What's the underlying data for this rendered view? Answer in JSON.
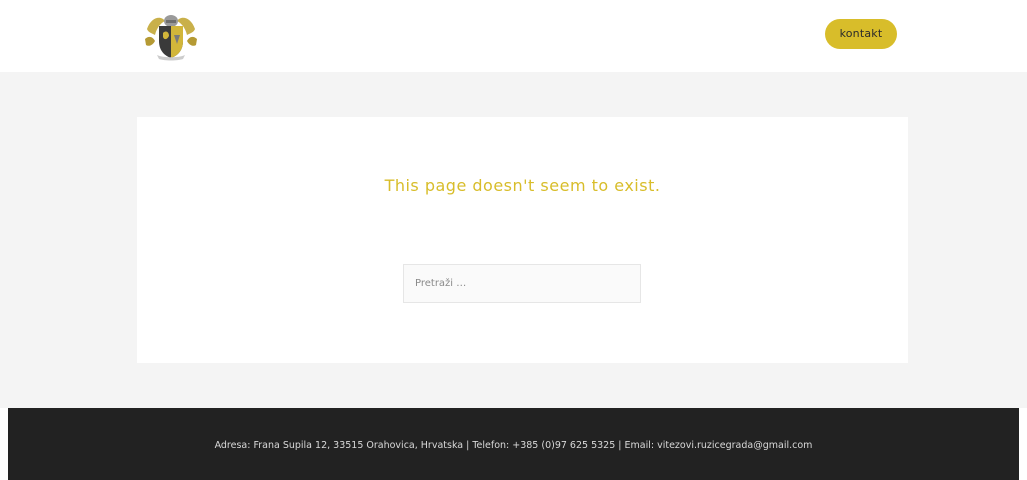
{
  "colors": {
    "accent": "#d8bd2a",
    "footer_bg": "#222222",
    "main_bg": "#f4f4f4"
  },
  "header": {
    "logo_icon": "coat-of-arms-logo",
    "contact_label": "kontakt"
  },
  "main": {
    "error_title": "This page doesn't seem to exist.",
    "search_placeholder": "Pretraži …"
  },
  "footer": {
    "text": "Adresa: Frana Supila 12, 33515 Orahovica, Hrvatska | Telefon: +385 (0)97 625 5325 | Email: vitezovi.ruzicegrada@gmail.com"
  }
}
